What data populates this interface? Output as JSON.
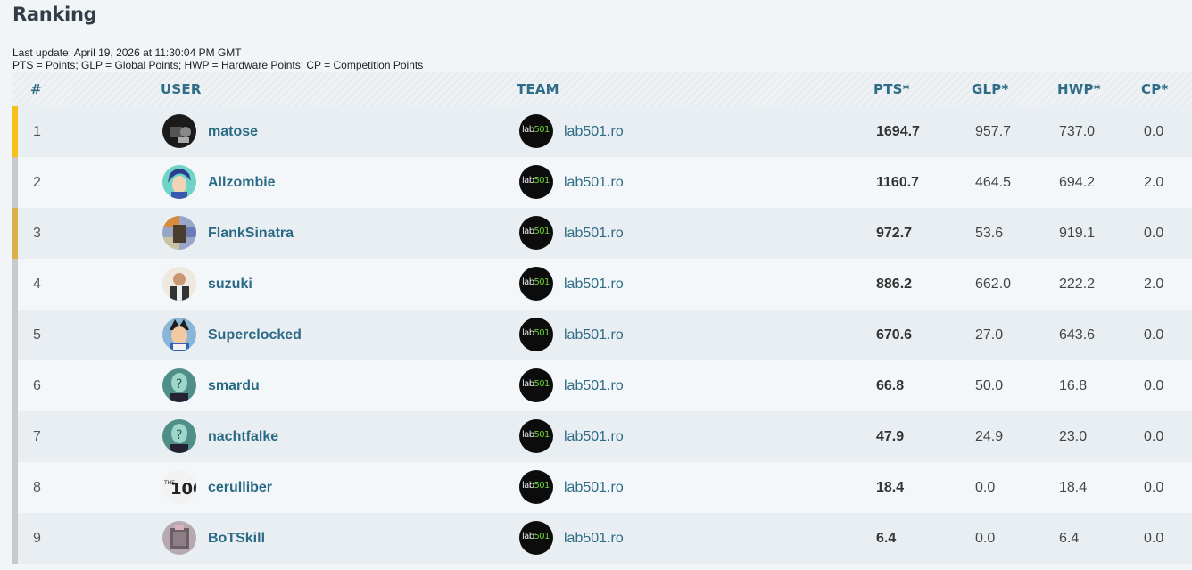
{
  "title": "Ranking",
  "meta": {
    "last_update": "Last update: April 19, 2026 at 11:30:04 PM GMT",
    "legend": "PTS = Points; GLP = Global Points; HWP = Hardware Points; CP = Competition Points"
  },
  "headers": {
    "rank": "#",
    "user": "USER",
    "team": "TEAM",
    "pts": "PTS*",
    "glp": "GLP*",
    "hwp": "HWP*",
    "cp": "CP*"
  },
  "team_logo": {
    "text": "lab",
    "accent": "501"
  },
  "colors": {
    "gold": "#f5c018",
    "silver": "#c9c9c9",
    "bronze": "#d9b24a",
    "default_bar": "#c9c9c9",
    "link": "#2b6a85"
  },
  "rows": [
    {
      "rank": "1",
      "user": "matose",
      "avatar": "dark-icon",
      "team": "lab501.ro",
      "pts": "1694.7",
      "glp": "957.7",
      "hwp": "737.0",
      "cp": "0.0"
    },
    {
      "rank": "2",
      "user": "Allzombie",
      "avatar": "anime-icon",
      "team": "lab501.ro",
      "pts": "1160.7",
      "glp": "464.5",
      "hwp": "694.2",
      "cp": "2.0"
    },
    {
      "rank": "3",
      "user": "FlankSinatra",
      "avatar": "mosaic-icon",
      "team": "lab501.ro",
      "pts": "972.7",
      "glp": "53.6",
      "hwp": "919.1",
      "cp": "0.0"
    },
    {
      "rank": "4",
      "user": "suzuki",
      "avatar": "person-icon",
      "team": "lab501.ro",
      "pts": "886.2",
      "glp": "662.0",
      "hwp": "222.2",
      "cp": "2.0"
    },
    {
      "rank": "5",
      "user": "Superclocked",
      "avatar": "vegeta-icon",
      "team": "lab501.ro",
      "pts": "670.6",
      "glp": "27.0",
      "hwp": "643.6",
      "cp": "0.0"
    },
    {
      "rank": "6",
      "user": "smardu",
      "avatar": "question-icon",
      "team": "lab501.ro",
      "pts": "66.8",
      "glp": "50.0",
      "hwp": "16.8",
      "cp": "0.0"
    },
    {
      "rank": "7",
      "user": "nachtfalke",
      "avatar": "question-icon",
      "team": "lab501.ro",
      "pts": "47.9",
      "glp": "24.9",
      "hwp": "23.0",
      "cp": "0.0"
    },
    {
      "rank": "8",
      "user": "cerulliber",
      "avatar": "hundred-icon",
      "team": "lab501.ro",
      "pts": "18.4",
      "glp": "0.0",
      "hwp": "18.4",
      "cp": "0.0"
    },
    {
      "rank": "9",
      "user": "BoTSkill",
      "avatar": "stack-icon",
      "team": "lab501.ro",
      "pts": "6.4",
      "glp": "0.0",
      "hwp": "6.4",
      "cp": "0.0"
    }
  ]
}
